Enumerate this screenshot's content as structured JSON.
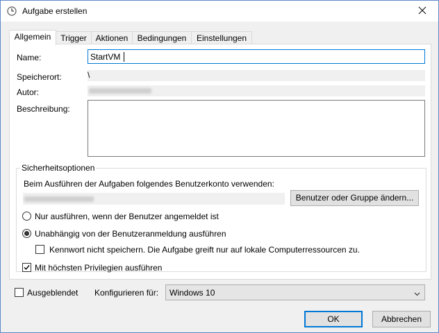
{
  "window": {
    "title": "Aufgabe erstellen"
  },
  "tabs": [
    {
      "label": "Allgemein"
    },
    {
      "label": "Trigger"
    },
    {
      "label": "Aktionen"
    },
    {
      "label": "Bedingungen"
    },
    {
      "label": "Einstellungen"
    }
  ],
  "general": {
    "name_label": "Name:",
    "name_value": "StartVM",
    "location_label": "Speicherort:",
    "location_value": "\\",
    "author_label": "Autor:",
    "description_label": "Beschreibung:",
    "description_value": ""
  },
  "security": {
    "group_title": "Sicherheitsoptionen",
    "account_prompt": "Beim Ausführen der Aufgaben folgendes Benutzerkonto verwenden:",
    "change_user_button": "Benutzer oder Gruppe ändern...",
    "radio_logged_on": "Nur ausführen, wenn der Benutzer angemeldet ist",
    "radio_independent": "Unabhängig von der Benutzeranmeldung ausführen",
    "no_store_password": "Kennwort nicht speichern. Die Aufgabe greift nur auf lokale Computerressourcen zu.",
    "highest_privileges": "Mit höchsten Privilegien ausführen",
    "radio_logged_on_checked": false,
    "radio_independent_checked": true,
    "no_store_password_checked": false,
    "highest_privileges_checked": true
  },
  "bottom": {
    "hidden_label": "Ausgeblendet",
    "hidden_checked": false,
    "configure_label": "Konfigurieren für:",
    "configure_value": "Windows 10"
  },
  "buttons": {
    "ok": "OK",
    "cancel": "Abbrechen"
  },
  "colors": {
    "accent": "#0078d7",
    "window_border": "#5b87c9"
  },
  "icons": {
    "title": "clock-icon",
    "close": "close-icon",
    "dropdown": "chevron-down-icon",
    "check": "checkmark-icon"
  }
}
